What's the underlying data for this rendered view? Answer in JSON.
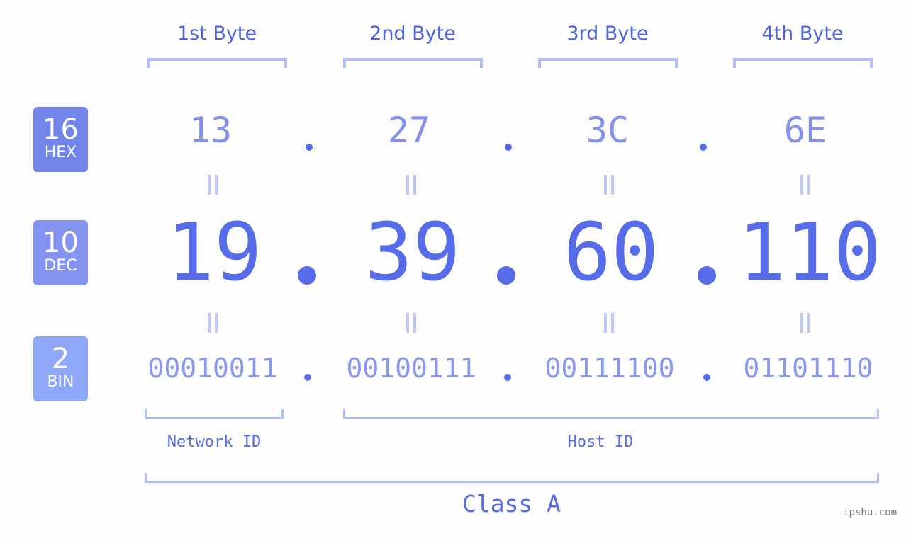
{
  "bytes": [
    {
      "label": "1st Byte",
      "hex": "13",
      "dec": "19",
      "bin": "00010011"
    },
    {
      "label": "2nd Byte",
      "hex": "27",
      "dec": "39",
      "bin": "00100111"
    },
    {
      "label": "3rd Byte",
      "hex": "3C",
      "dec": "60",
      "bin": "00111100"
    },
    {
      "label": "4th Byte",
      "hex": "6E",
      "dec": "110",
      "bin": "01101110"
    }
  ],
  "badges": {
    "hex": {
      "number": "16",
      "label": "HEX",
      "color": "#7384eb"
    },
    "dec": {
      "number": "10",
      "label": "DEC",
      "color": "#8493f0"
    },
    "bin": {
      "number": "2",
      "label": "BIN",
      "color": "#8fa7f8"
    }
  },
  "network_id_label": "Network ID",
  "host_id_label": "Host ID",
  "class_label": "Class A",
  "watermark": "ipshu.com",
  "colors": {
    "accent": "#566ce8",
    "bracket": "#b3bdf7",
    "hex_text": "#8490ea",
    "bin_text": "#8a98f0"
  }
}
